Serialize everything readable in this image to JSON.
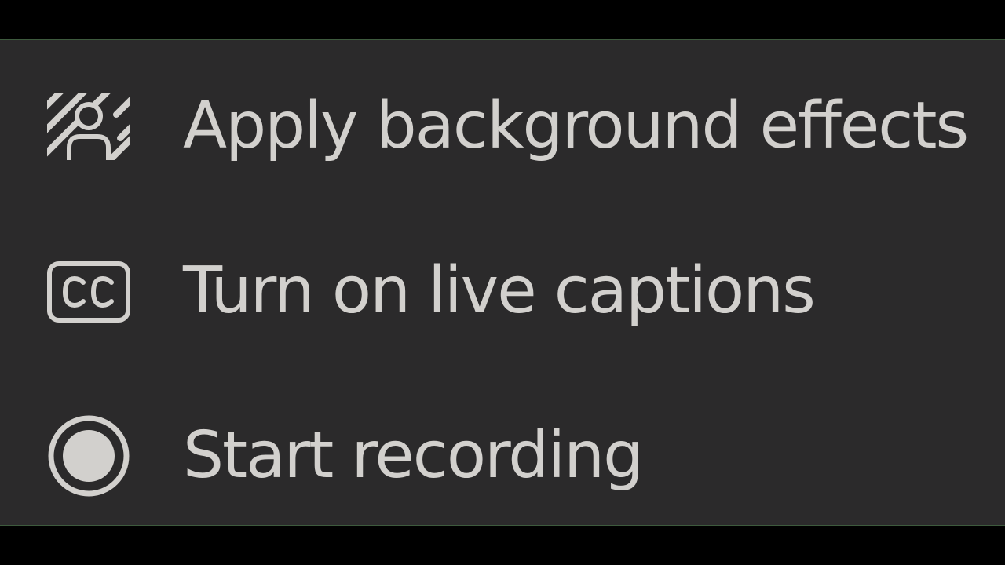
{
  "menu": {
    "items": [
      {
        "label": "Apply background effects",
        "icon": "background-effects-icon"
      },
      {
        "label": "Turn on live captions",
        "icon": "closed-captions-icon"
      },
      {
        "label": "Start recording",
        "icon": "record-icon"
      }
    ]
  },
  "colors": {
    "panel_background": "#2b2a2b",
    "outer_background": "#000000",
    "text": "#d2d0cd",
    "icon": "#d2d0cd"
  }
}
